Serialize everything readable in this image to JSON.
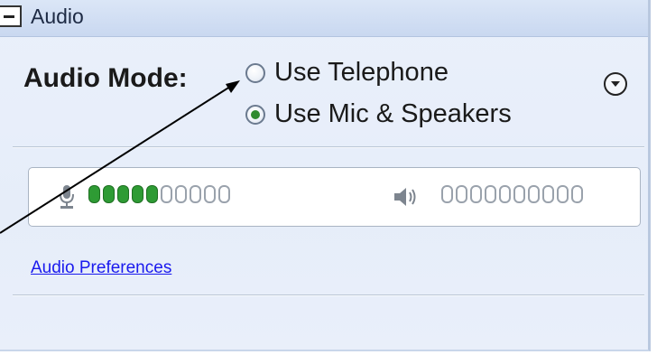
{
  "panel": {
    "title": "Audio",
    "collapse_icon": "minus-box-icon"
  },
  "audio_mode": {
    "label": "Audio Mode:",
    "options": [
      {
        "label": "Use Telephone",
        "selected": false
      },
      {
        "label": "Use Mic & Speakers",
        "selected": true
      }
    ],
    "menu_icon": "chevron-down-circle-icon"
  },
  "levels": {
    "mic": {
      "icon": "microphone-icon",
      "segments_total": 10,
      "segments_on": 5,
      "color_on": "#2e9b34"
    },
    "speaker": {
      "icon": "speaker-icon",
      "segments_total": 10,
      "segments_on": 0
    }
  },
  "links": {
    "audio_preferences": "Audio Preferences"
  },
  "colors": {
    "link": "#1a1aee",
    "selected_radio": "#2f8a2f",
    "panel_bg": "#e6edf9"
  }
}
